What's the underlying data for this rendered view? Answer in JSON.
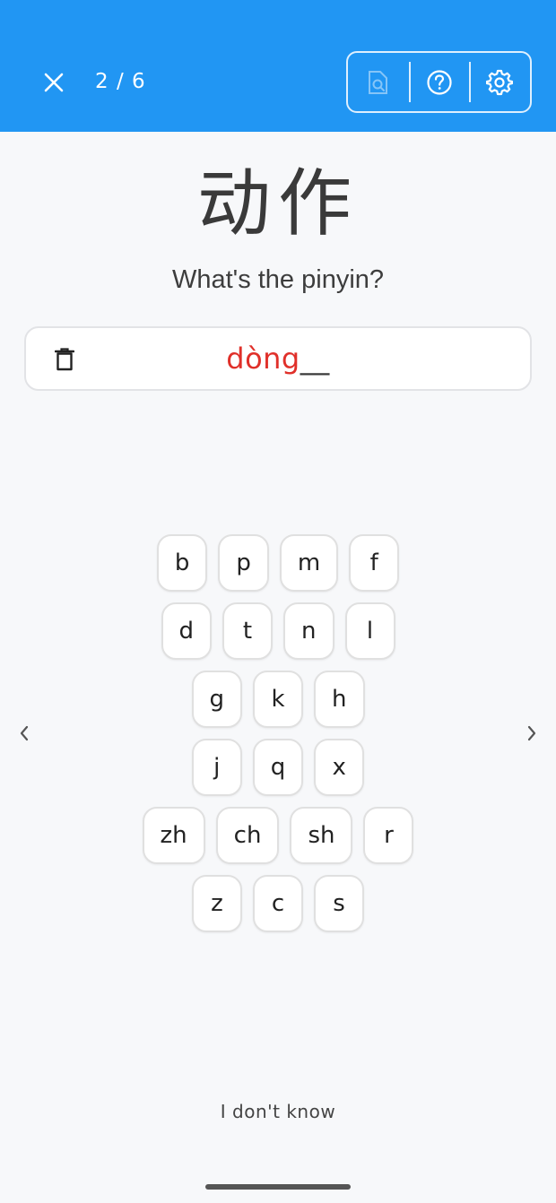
{
  "header": {
    "progress": "2 / 6",
    "icons": [
      "close-icon",
      "document-search-icon",
      "help-circle-icon",
      "gear-icon"
    ],
    "background_color": "#2196f3"
  },
  "card": {
    "hanzi": "动作",
    "prompt": "What's the pinyin?"
  },
  "answer": {
    "typed": "dòng",
    "blank": "__",
    "typed_color": "#e0302a"
  },
  "keyboard": {
    "rows": [
      [
        "b",
        "p",
        "m",
        "f"
      ],
      [
        "d",
        "t",
        "n",
        "l"
      ],
      [
        "g",
        "k",
        "h"
      ],
      [
        "j",
        "q",
        "x"
      ],
      [
        "zh",
        "ch",
        "sh",
        "r"
      ],
      [
        "z",
        "c",
        "s"
      ]
    ]
  },
  "footer": {
    "dont_know_label": "I don't know"
  }
}
